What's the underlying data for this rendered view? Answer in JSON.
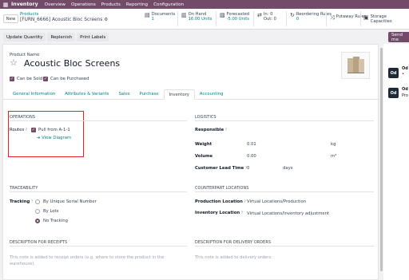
{
  "nav": {
    "app": "Inventory",
    "menus": [
      "Overview",
      "Operations",
      "Products",
      "Reporting",
      "Configuration"
    ]
  },
  "control": {
    "new_label": "New",
    "breadcrumb_parent": "Products",
    "breadcrumb_current": "[FURN_6666] Acoustic Bloc Screens",
    "stats": [
      {
        "icon": "documents-icon",
        "label": "Documents",
        "value": "1"
      },
      {
        "icon": "on-hand-icon",
        "label": "On Hand",
        "value": "16.00 Units"
      },
      {
        "icon": "forecast-icon",
        "label": "Forecasted",
        "value": "-5.00 Units"
      },
      {
        "icon": "in-out-icon",
        "label": "In: 0",
        "value": "Out: 0"
      },
      {
        "icon": "reorder-icon",
        "label": "Reordering Rules",
        "value": "0"
      },
      {
        "icon": "putaway-icon",
        "label": "Putaway Rules",
        "value": ""
      },
      {
        "icon": "storage-icon",
        "label": "Storage Capacities",
        "value": ""
      }
    ]
  },
  "actions": [
    "Update Quantity",
    "Replenish",
    "Print Labels"
  ],
  "send_label": "Send me",
  "product": {
    "name_label": "Product Name",
    "name": "Acoustic Bloc Screens",
    "can_be_sold": "Can be Sold",
    "can_be_purchased": "Can be Purchased"
  },
  "tabs": [
    "General Information",
    "Attributes & Variants",
    "Sales",
    "Purchase",
    "Inventory",
    "Accounting"
  ],
  "operations": {
    "heading": "OPERATIONS",
    "routes_label": "Routes",
    "route_value": "Pull from A-1-1",
    "view_diagram": "View Diagram"
  },
  "logistics": {
    "heading": "LOGISTICS",
    "responsible_label": "Responsible",
    "weight_label": "Weight",
    "weight_value": "0.01",
    "weight_unit": "kg",
    "volume_label": "Volume",
    "volume_value": "0.00",
    "volume_unit": "m³",
    "lead_time_label": "Customer Lead Time",
    "lead_time_value": "0",
    "lead_time_unit": "days"
  },
  "traceability": {
    "heading": "TRACEABILITY",
    "tracking_label": "Tracking",
    "options": [
      "By Unique Serial Number",
      "By Lots",
      "No Tracking"
    ],
    "selected": "No Tracking"
  },
  "counterpart": {
    "heading": "COUNTERPART LOCATIONS",
    "production_label": "Production Location",
    "production_value": "Virtual Locations/Production",
    "inventory_label": "Inventory Location",
    "inventory_value": "Virtual Locations/Inventory adjustment"
  },
  "receipts": {
    "heading": "DESCRIPTION FOR RECEIPTS",
    "placeholder": "This note is added to receipt orders (e.g. where to store the product in the warehouse)."
  },
  "delivery": {
    "heading": "DESCRIPTION FOR DELIVERY ORDERS",
    "placeholder": "This note is added to delivery orders."
  },
  "chatter": {
    "avatar_label": "Od",
    "msg1": "Od",
    "msg2": "Od",
    "msg2_sub": "Pro"
  },
  "colors": {
    "brand": "#714b67",
    "link": "#017e84",
    "highlight": "#e02424"
  }
}
